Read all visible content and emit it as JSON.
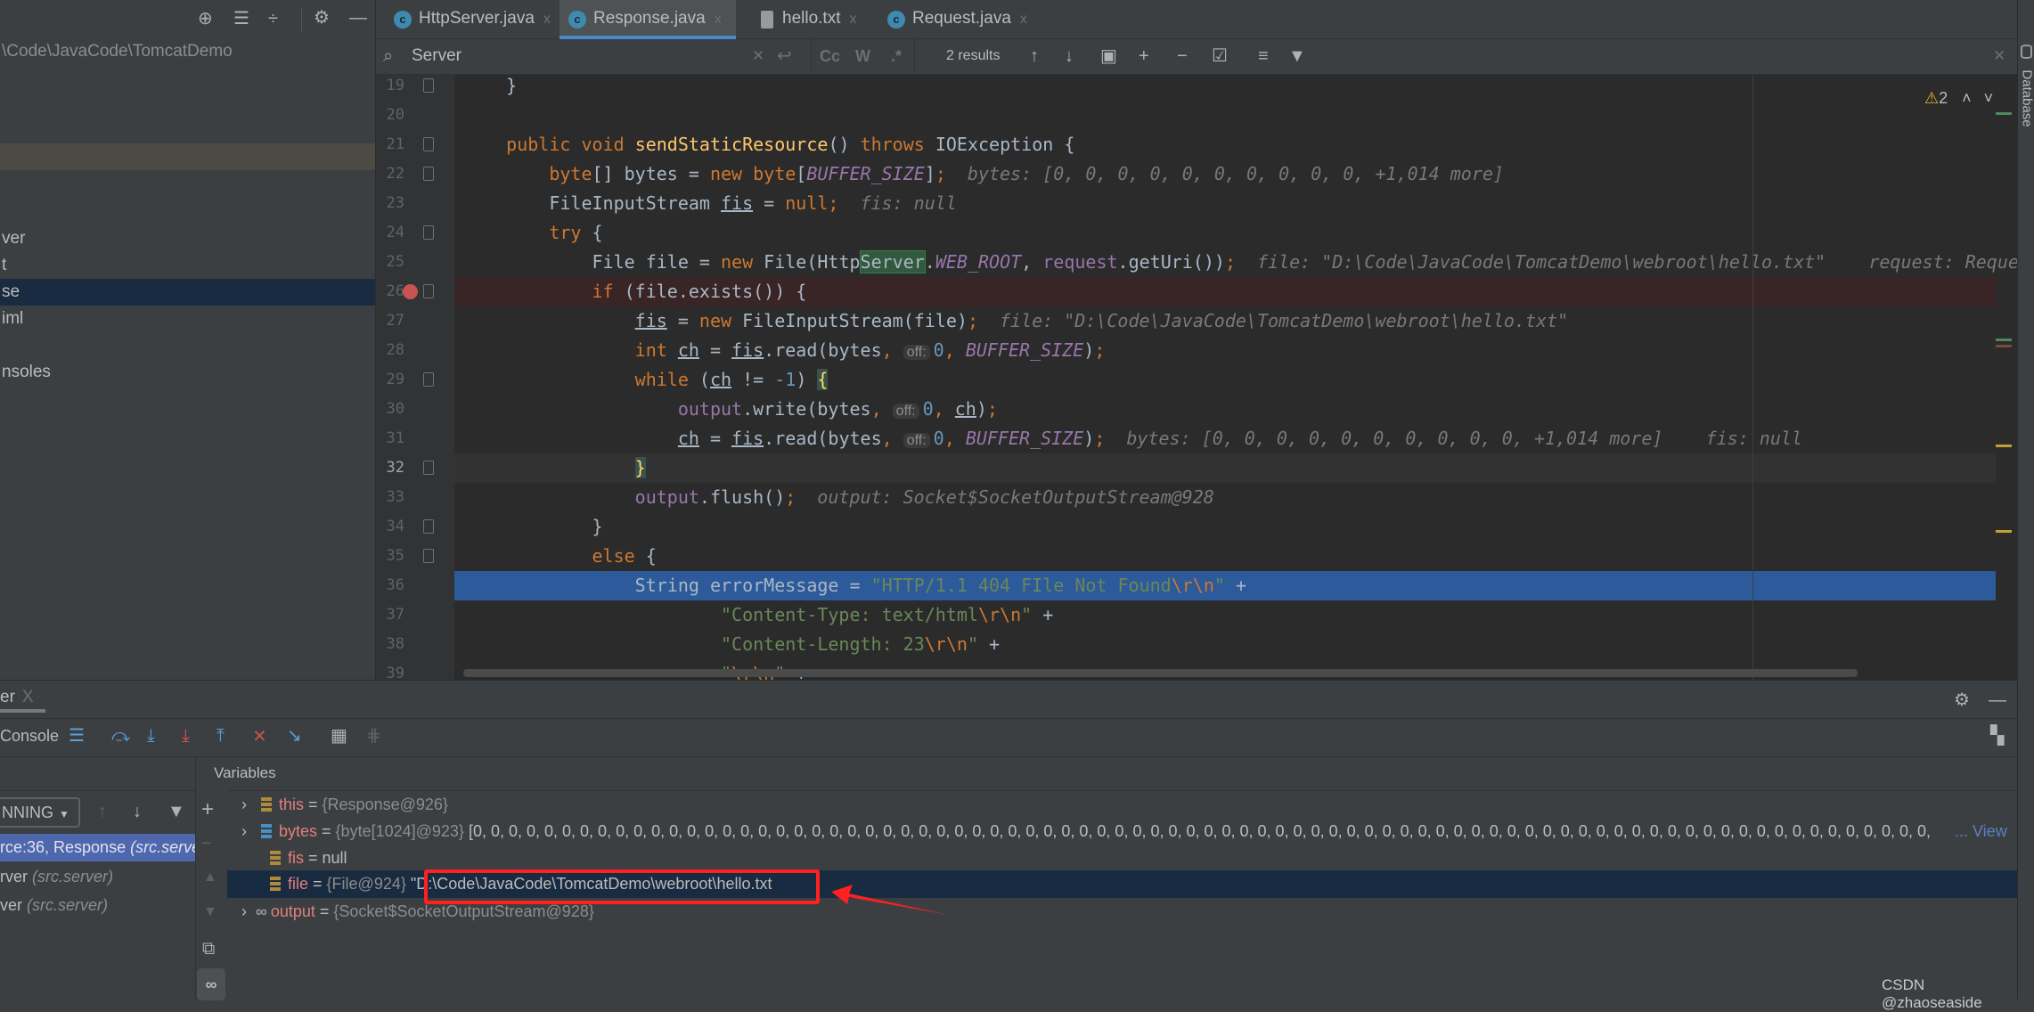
{
  "project": {
    "path": "\\Code\\JavaCode\\TomcatDemo",
    "items": [
      "ver",
      "t",
      "se",
      "iml",
      "nsoles"
    ],
    "toolbar": [
      "locate-icon",
      "expand-all-icon",
      "collapse-all-icon",
      "gear-icon",
      "minimize-icon"
    ]
  },
  "tabs": [
    {
      "label": "HttpServer.java",
      "icon": "java-class-icon",
      "close": "x"
    },
    {
      "label": "Response.java",
      "icon": "java-class-icon",
      "close": "x",
      "selected": true
    },
    {
      "label": "hello.txt",
      "icon": "text-file-icon",
      "close": "x"
    },
    {
      "label": "Request.java",
      "icon": "java-class-icon",
      "close": "x"
    }
  ],
  "search": {
    "value": "Server",
    "match_case": "Cc",
    "words": "W",
    "regex": ".*",
    "results": "2 results"
  },
  "editor": {
    "warnings": "2",
    "lines": [
      {
        "n": "19",
        "tokens": [
          "    }"
        ]
      },
      {
        "n": "20",
        "tokens": []
      },
      {
        "n": "21",
        "tokens": [
          "    ",
          [
            "public",
            "kw"
          ],
          " ",
          [
            "void",
            "kw"
          ],
          " ",
          [
            "sendStaticResource",
            "fn"
          ],
          "() ",
          [
            "throws",
            "kw"
          ],
          " IOException {"
        ]
      },
      {
        "n": "22",
        "tokens": [
          "        ",
          [
            "byte",
            "kw"
          ],
          "[] bytes = ",
          [
            "new",
            "kw"
          ],
          " ",
          [
            "byte",
            "kw"
          ],
          "[",
          [
            "BUFFER_SIZE",
            "field"
          ],
          "]",
          [
            ";",
            "kw"
          ]
        ],
        "hint": "bytes: [0, 0, 0, 0, 0, 0, 0, 0, 0, 0, +1,014 more]"
      },
      {
        "n": "23",
        "tokens": [
          "        FileInputStream ",
          [
            "fis",
            "ul"
          ],
          " = ",
          [
            "null",
            "kw"
          ],
          [
            ";",
            "kw"
          ]
        ],
        "hint": "fis: null"
      },
      {
        "n": "24",
        "tokens": [
          "        ",
          [
            "try",
            "kw"
          ],
          " {"
        ]
      },
      {
        "n": "25",
        "tokens": [
          "            File file = ",
          [
            "new",
            "kw"
          ],
          " File(Http",
          [
            "Server",
            "match"
          ],
          ".",
          [
            "WEB_ROOT",
            "field"
          ],
          ", ",
          [
            "request",
            "fieldn"
          ],
          ".getUri())",
          [
            ";",
            "kw"
          ]
        ],
        "hint": "file: \"D:\\Code\\JavaCode\\TomcatDemo\\webroot\\hello.txt\"    request: Reque"
      },
      {
        "n": "26",
        "tokens": [
          "            ",
          [
            "if",
            "kw"
          ],
          " (file.exists()) {"
        ],
        "state": "breakpoint"
      },
      {
        "n": "27",
        "tokens": [
          "                ",
          [
            "fis",
            "ul"
          ],
          " = ",
          [
            "new",
            "kw"
          ],
          " FileInputStream(file)",
          [
            ";",
            "kw"
          ]
        ],
        "hint": "file: \"D:\\Code\\JavaCode\\TomcatDemo\\webroot\\hello.txt\""
      },
      {
        "n": "28",
        "tokens": [
          "                ",
          [
            "int",
            "kw"
          ],
          " ",
          [
            "ch",
            "ul"
          ],
          " = ",
          [
            "fis",
            "ul"
          ],
          ".read(bytes",
          [
            ",",
            "kw"
          ],
          " ",
          [
            "off:",
            "chip"
          ],
          [
            "0",
            "num"
          ],
          [
            ",",
            "kw"
          ],
          " ",
          [
            "BUFFER_SIZE",
            "field"
          ],
          ")",
          [
            ";",
            "kw"
          ]
        ]
      },
      {
        "n": "29",
        "tokens": [
          "                ",
          [
            "while",
            "kw"
          ],
          " (",
          [
            "ch",
            "ul"
          ],
          " != ",
          [
            "-1",
            "num"
          ],
          ") ",
          [
            "{",
            "brace"
          ]
        ]
      },
      {
        "n": "30",
        "tokens": [
          "                    ",
          [
            "output",
            "fieldn"
          ],
          ".write(bytes",
          [
            ",",
            "kw"
          ],
          " ",
          [
            "off:",
            "chip"
          ],
          [
            "0",
            "num"
          ],
          [
            ",",
            "kw"
          ],
          " ",
          [
            "ch",
            "ul"
          ],
          ")",
          [
            ";",
            "kw"
          ]
        ]
      },
      {
        "n": "31",
        "tokens": [
          "                    ",
          [
            "ch",
            "ul"
          ],
          " = ",
          [
            "fis",
            "ul"
          ],
          ".read(bytes",
          [
            ",",
            "kw"
          ],
          " ",
          [
            "off:",
            "chip"
          ],
          [
            "0",
            "num"
          ],
          [
            ",",
            "kw"
          ],
          " ",
          [
            "BUFFER_SIZE",
            "field"
          ],
          ")",
          [
            ";",
            "kw"
          ]
        ],
        "hint": "bytes: [0, 0, 0, 0, 0, 0, 0, 0, 0, 0, +1,014 more]    fis: null"
      },
      {
        "n": "32",
        "tokens": [
          "                ",
          [
            "}",
            "brace"
          ]
        ],
        "state": "current"
      },
      {
        "n": "33",
        "tokens": [
          "                ",
          [
            "output",
            "fieldn"
          ],
          ".flush()",
          [
            ";",
            "kw"
          ]
        ],
        "hint": "output: Socket$SocketOutputStream@928"
      },
      {
        "n": "34",
        "tokens": [
          "            }"
        ]
      },
      {
        "n": "35",
        "tokens": [
          "            ",
          [
            "else",
            "kw"
          ],
          " {"
        ]
      },
      {
        "n": "36",
        "tokens": [
          "                String errorMessage = ",
          [
            "\"HTTP/1.1 404 FIle Not Found",
            "str"
          ],
          [
            "\\r\\n",
            "esc"
          ],
          [
            "\"",
            "str"
          ],
          " +"
        ],
        "state": "execution"
      },
      {
        "n": "37",
        "tokens": [
          "                        ",
          [
            "\"Content-Type: text/html",
            "str"
          ],
          [
            "\\r\\n",
            "esc"
          ],
          [
            "\"",
            "str"
          ],
          " +"
        ]
      },
      {
        "n": "38",
        "tokens": [
          "                        ",
          [
            "\"Content-Length: 23",
            "str"
          ],
          [
            "\\r\\n",
            "esc"
          ],
          [
            "\"",
            "str"
          ],
          " +"
        ]
      },
      {
        "n": "39",
        "tokens": [
          "                        ",
          [
            "\"",
            "str"
          ],
          [
            "\\r\\n",
            "esc"
          ],
          [
            "\"",
            "str"
          ],
          " +"
        ]
      }
    ]
  },
  "right_sidebar": {
    "label": "Database"
  },
  "debug": {
    "tab_label": "er",
    "tab_close": "X",
    "console_label": "Console",
    "thread_select": "NNING",
    "frames": [
      {
        "text": "rce:36, Response ",
        "pkg": "(src.serve",
        "selected": true
      },
      {
        "text": "rver ",
        "pkg": "(src.server)"
      },
      {
        "text": "ver ",
        "pkg": "(src.server)"
      }
    ],
    "variables_title": "Variables",
    "variables": [
      {
        "name": "this",
        "value": "{Response@926}",
        "icon": "field-icon",
        "expandable": true
      },
      {
        "name": "bytes",
        "value": "{byte[1024]@923}",
        "extra": "[0, 0, 0, 0, 0, 0, 0, 0, 0, 0, 0, 0, 0, 0, 0, 0, 0, 0, 0, 0, 0, 0, 0, 0, 0, 0, 0, 0, 0, 0, 0, 0, 0, 0, 0, 0, 0, 0, 0, 0, 0, 0, 0, 0, 0, 0, 0, 0, 0, 0, 0, 0, 0, 0, 0, 0, 0, 0, 0, 0, 0, 0, 0, 0, 0, 0, 0, 0, 0, 0, 0, 0, 0, 0, 0, 0, 0, 0, 0, 0, 0, 0,",
        "link": "... View",
        "icon": "array-icon",
        "expandable": true
      },
      {
        "name": "fis",
        "value": "null",
        "icon": "field-icon",
        "expandable": false
      },
      {
        "name": "file",
        "value": "{File@924}",
        "extra": "\"D:\\Code\\JavaCode\\TomcatDemo\\webroot\\hello.txt",
        "icon": "field-icon",
        "expandable": false,
        "selected": true
      },
      {
        "name": "output",
        "value": "{Socket$SocketOutputStream@928}",
        "icon": "watch-icon",
        "expandable": true
      }
    ]
  },
  "annotation": {
    "color": "#ff2020"
  },
  "watermark": "CSDN @zhaoseaside",
  "colors": {
    "accent": "#4a88c7",
    "execution_line": "#2d5a9a",
    "breakpoint_line": "#3a2526",
    "selected_frame": "#4f67ad"
  }
}
